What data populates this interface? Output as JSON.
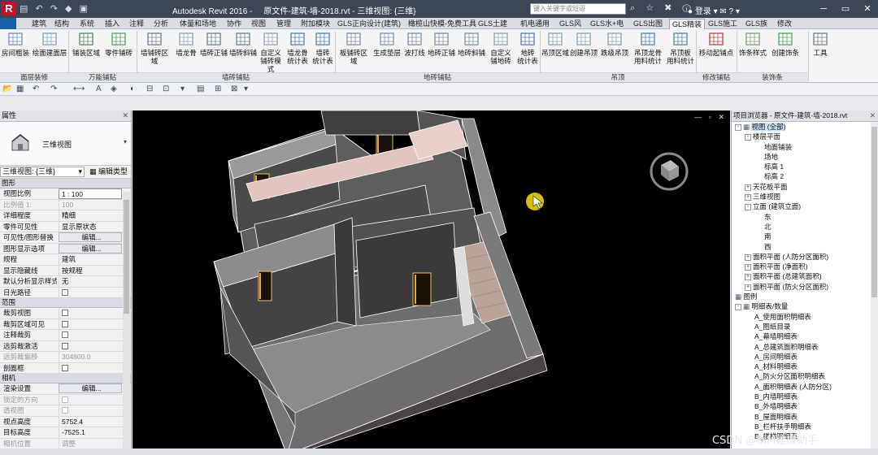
{
  "app": {
    "logo_letter": "R",
    "name": "Autodesk Revit 2016 -",
    "document": "原文件-建筑-墙-2018.rvt - 三维视图: {三维}",
    "search_placeholder": "键入关键字或短语",
    "login_label": "登录"
  },
  "menu_tabs": [
    "建筑",
    "结构",
    "系统",
    "插入",
    "注释",
    "分析",
    "体量和场地",
    "协作",
    "视图",
    "管理",
    "附加模块",
    "GLS正向设计(建筑)",
    "橄榄山快模-免费工具",
    "GLS土建",
    "机电通用",
    "GLS风",
    "GLS水+电",
    "GLS出图",
    "GLS精装",
    "GLS施工",
    "GLS族",
    "修改"
  ],
  "active_tab": "GLS精装",
  "ribbon": {
    "buttons": [
      {
        "label": "房间粗装",
        "icon": "room-rough-icon"
      },
      {
        "label": "绘面建面层",
        "icon": "face-layer-icon"
      },
      {
        "label": "铺装区域",
        "icon": "paving-area-icon"
      },
      {
        "label": "零件铺砖",
        "icon": "parts-tile-icon"
      },
      {
        "label": "墙铺砖区域",
        "icon": "wall-tile-area-icon"
      },
      {
        "label": "墙龙骨",
        "icon": "wall-keel-icon"
      },
      {
        "label": "墙砖正铺",
        "icon": "wall-tile-straight-icon"
      },
      {
        "label": "墙砖斜铺",
        "icon": "wall-tile-diagonal-icon"
      },
      {
        "label": "自定义\n铺砖模式",
        "icon": "custom-tile-icon"
      },
      {
        "label": "墙龙骨\n统计表",
        "icon": "wall-keel-schedule-icon"
      },
      {
        "label": "墙砖\n统计表",
        "icon": "wall-tile-schedule-icon"
      },
      {
        "label": "板铺砖区域",
        "icon": "floor-tile-area-icon"
      },
      {
        "label": "生成垫层",
        "icon": "cushion-layer-icon"
      },
      {
        "label": "波打线",
        "icon": "border-line-icon"
      },
      {
        "label": "地砖正铺",
        "icon": "floor-tile-straight-icon"
      },
      {
        "label": "地砖斜铺",
        "icon": "floor-tile-diagonal-icon"
      },
      {
        "label": "自定义\n铺地砖",
        "icon": "custom-floor-icon"
      },
      {
        "label": "地砖\n统计表",
        "icon": "floor-tile-schedule-icon"
      },
      {
        "label": "吊顶区域",
        "icon": "ceiling-area-icon"
      },
      {
        "label": "创建吊顶",
        "icon": "create-ceiling-icon"
      },
      {
        "label": "跌级吊顶",
        "icon": "drop-ceiling-icon"
      },
      {
        "label": "吊顶龙骨\n用料统计",
        "icon": "ceiling-keel-schedule-icon"
      },
      {
        "label": "吊顶板\n用料统计",
        "icon": "ceiling-board-schedule-icon"
      },
      {
        "label": "移动起铺点",
        "icon": "move-start-point-icon"
      },
      {
        "label": "饰条样式",
        "icon": "trim-style-icon"
      },
      {
        "label": "创建饰条",
        "icon": "create-trim-icon"
      },
      {
        "label": "工具",
        "icon": "tools-icon"
      }
    ],
    "panels": [
      "面层装修",
      "万能铺贴",
      "墙砖铺贴",
      "地砖铺贴",
      "吊顶",
      "修改铺贴",
      "装饰条"
    ]
  },
  "properties": {
    "title": "属性",
    "type_name": "三维视图",
    "selector": "三维视图: {三维}",
    "edit_type": "编辑类型",
    "rows": [
      {
        "section": "图形"
      },
      {
        "k": "视图比例",
        "v": "1 : 100",
        "kind": "input"
      },
      {
        "k": "比例值 1:",
        "v": "100",
        "kind": "grey"
      },
      {
        "k": "详细程度",
        "v": "精细"
      },
      {
        "k": "零件可见性",
        "v": "显示原状态"
      },
      {
        "k": "可见性/图形替换",
        "v": "编辑...",
        "kind": "btn"
      },
      {
        "k": "图形显示选项",
        "v": "编辑...",
        "kind": "btn"
      },
      {
        "k": "规程",
        "v": "建筑"
      },
      {
        "k": "显示隐藏线",
        "v": "按规程"
      },
      {
        "k": "默认分析显示样式",
        "v": "无"
      },
      {
        "k": "日光路径",
        "v": "",
        "kind": "cb"
      },
      {
        "section": "范围"
      },
      {
        "k": "裁剪视图",
        "v": "",
        "kind": "cb"
      },
      {
        "k": "裁剪区域可见",
        "v": "",
        "kind": "cb"
      },
      {
        "k": "注释裁剪",
        "v": "",
        "kind": "cb"
      },
      {
        "k": "远剪裁激活",
        "v": "",
        "kind": "cb"
      },
      {
        "k": "远剪裁偏移",
        "v": "304800.0",
        "kind": "grey"
      },
      {
        "k": "剖面框",
        "v": "",
        "kind": "cb"
      },
      {
        "section": "相机"
      },
      {
        "k": "渲染设置",
        "v": "编辑...",
        "kind": "btn"
      },
      {
        "k": "锁定的方向",
        "v": "",
        "kind": "greycb"
      },
      {
        "k": "透视图",
        "v": "",
        "kind": "greycb"
      },
      {
        "k": "视点高度",
        "v": "5752.4"
      },
      {
        "k": "目标高度",
        "v": "-7525.1"
      },
      {
        "k": "相机位置",
        "v": "调整",
        "kind": "grey"
      }
    ]
  },
  "browser": {
    "title": "项目浏览器 - 原文件-建筑-墙-2018.rvt",
    "nodes": [
      {
        "label": "视图 (全部)",
        "level": 0,
        "exp": "-",
        "icon": true,
        "selected": true
      },
      {
        "label": "楼层平面",
        "level": 1,
        "exp": "-"
      },
      {
        "label": "地面铺装",
        "level": 2
      },
      {
        "label": "场地",
        "level": 2
      },
      {
        "label": "标高 1",
        "level": 2
      },
      {
        "label": "标高 2",
        "level": 2
      },
      {
        "label": "天花板平面",
        "level": 1,
        "exp": "+"
      },
      {
        "label": "三维视图",
        "level": 1,
        "exp": "+"
      },
      {
        "label": "立面 (建筑立面)",
        "level": 1,
        "exp": "-"
      },
      {
        "label": "东",
        "level": 2
      },
      {
        "label": "北",
        "level": 2
      },
      {
        "label": "南",
        "level": 2
      },
      {
        "label": "西",
        "level": 2
      },
      {
        "label": "面积平面 (人防分区面积)",
        "level": 1,
        "exp": "+"
      },
      {
        "label": "面积平面 (净面积)",
        "level": 1,
        "exp": "+"
      },
      {
        "label": "面积平面 (总建筑面积)",
        "level": 1,
        "exp": "+"
      },
      {
        "label": "面积平面 (防火分区面积)",
        "level": 1,
        "exp": "+"
      },
      {
        "label": "图例",
        "level": 0,
        "exp": "",
        "icon": true
      },
      {
        "label": "明细表/数量",
        "level": 0,
        "exp": "-",
        "icon": true
      },
      {
        "label": "A_使用面积明细表",
        "level": 1
      },
      {
        "label": "A_图纸目录",
        "level": 1
      },
      {
        "label": "A_幕墙明细表",
        "level": 1
      },
      {
        "label": "A_总建筑面积明细表",
        "level": 1
      },
      {
        "label": "A_房间明细表",
        "level": 1
      },
      {
        "label": "A_材料明细表",
        "level": 1
      },
      {
        "label": "A_防火分区面积明细表",
        "level": 1
      },
      {
        "label": "A_面积明细表 (人防分区)",
        "level": 1
      },
      {
        "label": "B_内墙明细表",
        "level": 1
      },
      {
        "label": "B_外墙明细表",
        "level": 1
      },
      {
        "label": "B_屋面明细表",
        "level": 1
      },
      {
        "label": "B_栏杆扶手明细表",
        "level": 1
      },
      {
        "label": "B_楼梯明细表",
        "level": 1
      }
    ]
  },
  "watermark": "CSDN @BIM建模助手",
  "colors": {
    "title_bg": "#3c4655",
    "viewport_bg": "#000000",
    "cursor": "#f5e400"
  }
}
